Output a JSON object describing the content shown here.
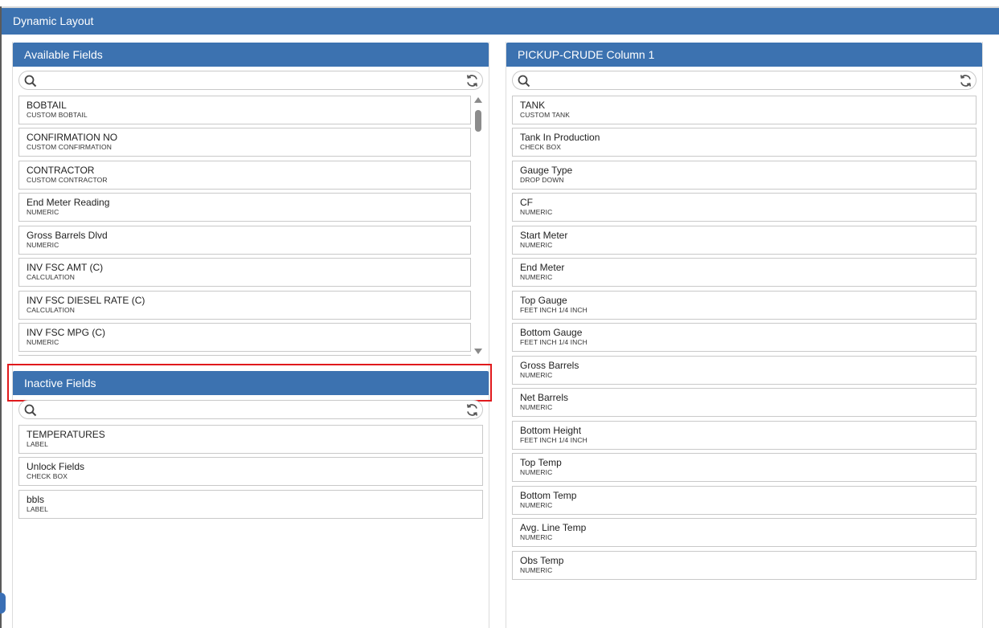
{
  "window": {
    "title": "Dynamic Layout"
  },
  "available": {
    "header": "Available Fields",
    "search_placeholder": "",
    "items": [
      {
        "name": "BOBTAIL",
        "type": "CUSTOM BOBTAIL"
      },
      {
        "name": "CONFIRMATION NO",
        "type": "CUSTOM CONFIRMATION"
      },
      {
        "name": "CONTRACTOR",
        "type": "CUSTOM CONTRACTOR"
      },
      {
        "name": "End Meter Reading",
        "type": "NUMERIC"
      },
      {
        "name": "Gross Barrels Dlvd",
        "type": "NUMERIC"
      },
      {
        "name": "INV FSC AMT (C)",
        "type": "CALCULATION"
      },
      {
        "name": "INV FSC DIESEL RATE (C)",
        "type": "CALCULATION"
      },
      {
        "name": "INV FSC MPG (C)",
        "type": "NUMERIC"
      }
    ]
  },
  "inactive": {
    "header": "Inactive Fields",
    "search_placeholder": "",
    "items": [
      {
        "name": "TEMPERATURES",
        "type": "LABEL"
      },
      {
        "name": "Unlock Fields",
        "type": "CHECK BOX"
      },
      {
        "name": "bbls",
        "type": "LABEL"
      }
    ]
  },
  "column1": {
    "header": "PICKUP-CRUDE Column 1",
    "search_placeholder": "",
    "items": [
      {
        "name": "TANK",
        "type": "CUSTOM TANK"
      },
      {
        "name": "Tank In Production",
        "type": "CHECK BOX"
      },
      {
        "name": "Gauge Type",
        "type": "DROP DOWN"
      },
      {
        "name": "CF",
        "type": "NUMERIC"
      },
      {
        "name": "Start Meter",
        "type": "NUMERIC"
      },
      {
        "name": "End Meter",
        "type": "NUMERIC"
      },
      {
        "name": "Top Gauge",
        "type": "FEET INCH 1/4 INCH"
      },
      {
        "name": "Bottom Gauge",
        "type": "FEET INCH 1/4 INCH"
      },
      {
        "name": "Gross Barrels",
        "type": "NUMERIC"
      },
      {
        "name": "Net Barrels",
        "type": "NUMERIC"
      },
      {
        "name": "Bottom Height",
        "type": "FEET INCH 1/4 INCH"
      },
      {
        "name": "Top Temp",
        "type": "NUMERIC"
      },
      {
        "name": "Bottom Temp",
        "type": "NUMERIC"
      },
      {
        "name": "Avg. Line Temp",
        "type": "NUMERIC"
      },
      {
        "name": "Obs Temp",
        "type": "NUMERIC"
      }
    ]
  },
  "icons": {
    "search": "search-icon",
    "refresh": "refresh-icon"
  },
  "colors": {
    "header_blue": "#3c72b0",
    "highlight_red": "#e0191c"
  }
}
